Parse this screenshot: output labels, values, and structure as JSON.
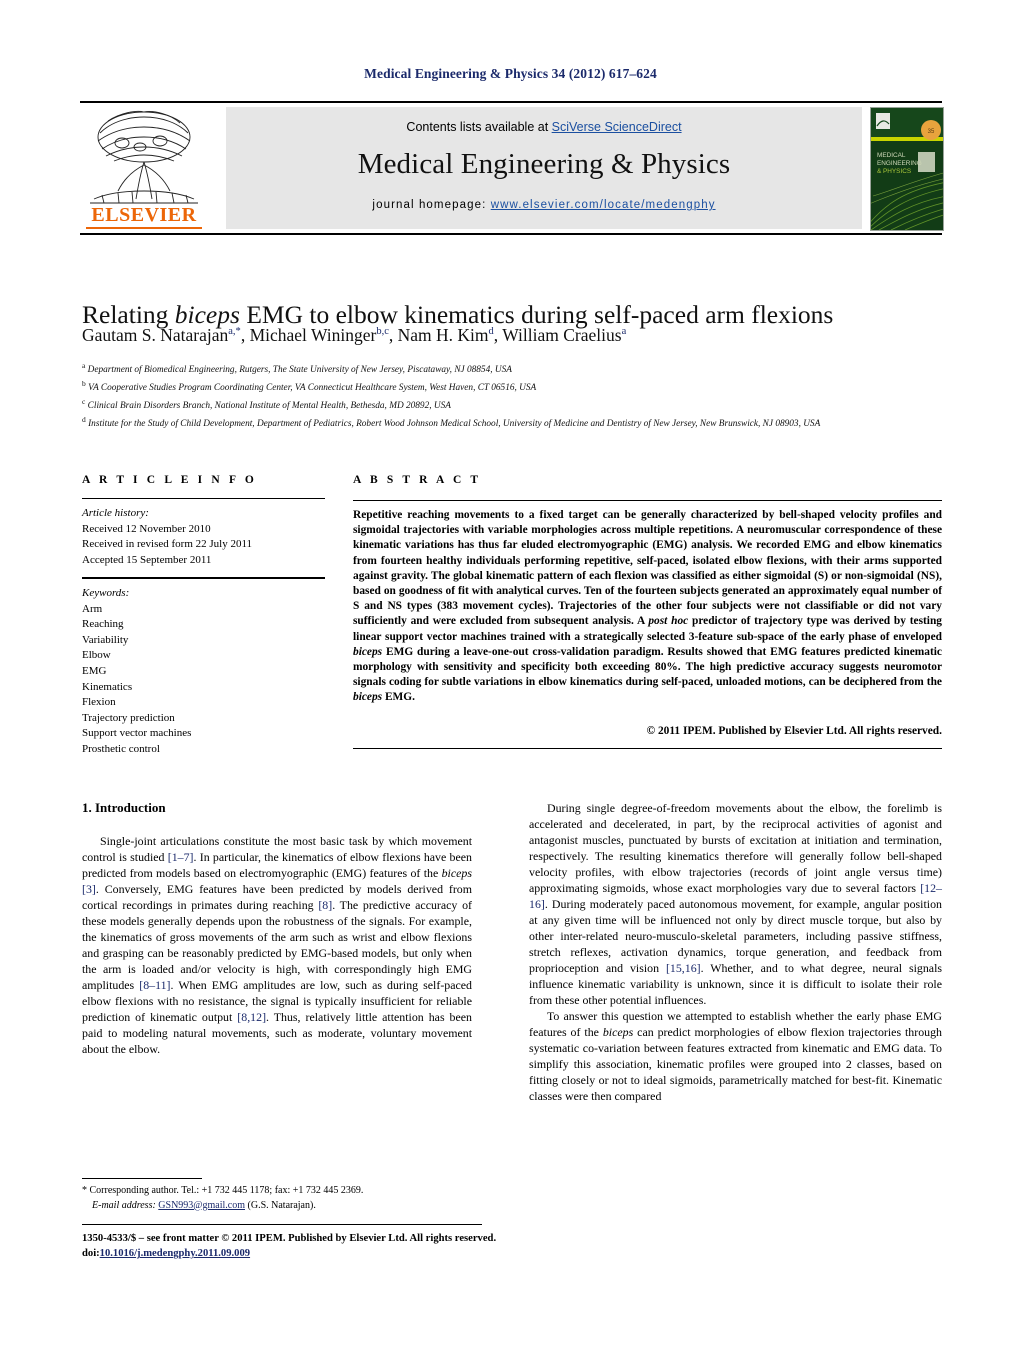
{
  "running_head": "Medical Engineering & Physics 34 (2012) 617–624",
  "banner": {
    "contents_prefix": "Contents lists available at ",
    "contents_link": "SciVerse ScienceDirect",
    "journal_title": "Medical Engineering & Physics",
    "homepage_prefix": "journal homepage: ",
    "homepage_url": "www.elsevier.com/locate/medengphy",
    "publisher_logo_text": "ELSEVIER",
    "cover_text_line1": "MEDICAL",
    "cover_text_line2": "ENGINEERING",
    "cover_text_line3": "& PHYSICS"
  },
  "article": {
    "title_part1": "Relating ",
    "title_italic": "biceps",
    "title_part2": " EMG to elbow kinematics during self-paced arm flexions",
    "authors_html": "Gautam S. Natarajan, Michael Wininger, Nam H. Kim, William Craelius",
    "affiliations": [
      {
        "marker": "a",
        "text": "Department of Biomedical Engineering, Rutgers, The State University of New Jersey, Piscataway, NJ 08854, USA"
      },
      {
        "marker": "b",
        "text": "VA Cooperative Studies Program Coordinating Center, VA Connecticut Healthcare System, West Haven, CT 06516, USA"
      },
      {
        "marker": "c",
        "text": "Clinical Brain Disorders Branch, National Institute of Mental Health, Bethesda, MD 20892, USA"
      },
      {
        "marker": "d",
        "text": "Institute for the Study of Child Development, Department of Pediatrics, Robert Wood Johnson Medical School, University of Medicine and Dentistry of New Jersey, New Brunswick, NJ 08903, USA"
      }
    ]
  },
  "article_info": {
    "heading": "A R T I C L E  I N F O",
    "history_label": "Article history:",
    "history": [
      "Received 12 November 2010",
      "Received in revised form 22 July 2011",
      "Accepted 15 September 2011"
    ],
    "keywords_label": "Keywords:",
    "keywords": [
      "Arm",
      "Reaching",
      "Variability",
      "Elbow",
      "EMG",
      "Kinematics",
      "Flexion",
      "Trajectory prediction",
      "Support vector machines",
      "Prosthetic control"
    ]
  },
  "abstract": {
    "heading": "A B S T R A C T",
    "body": "Repetitive reaching movements to a fixed target can be generally characterized by bell-shaped velocity profiles and sigmoidal trajectories with variable morphologies across multiple repetitions. A neuromuscular correspondence of these kinematic variations has thus far eluded electromyographic (EMG) analysis. We recorded EMG and elbow kinematics from fourteen healthy individuals performing repetitive, self-paced, isolated elbow flexions, with their arms supported against gravity. The global kinematic pattern of each flexion was classified as either sigmoidal (S) or non-sigmoidal (NS), based on goodness of fit with analytical curves. Ten of the fourteen subjects generated an approximately equal number of S and NS types (383 movement cycles). Trajectories of the other four subjects were not classifiable or did not vary sufficiently and were excluded from subsequent analysis. A post hoc predictor of trajectory type was derived by testing linear support vector machines trained with a strategically selected 3-feature sub-space of the early phase of enveloped biceps EMG during a leave-one-out cross-validation paradigm. Results showed that EMG features predicted kinematic morphology with sensitivity and specificity both exceeding 80%. The high predictive accuracy suggests neuromotor signals coding for subtle variations in elbow kinematics during self-paced, unloaded motions, can be deciphered from the biceps EMG.",
    "copyright": "© 2011 IPEM. Published by Elsevier Ltd. All rights reserved."
  },
  "body": {
    "intro_heading": "1. Introduction",
    "left_paragraph": "Single-joint articulations constitute the most basic task by which movement control is studied [1–7]. In particular, the kinematics of elbow flexions have been predicted from models based on electromyographic (EMG) features of the biceps [3]. Conversely, EMG features have been predicted by models derived from cortical recordings in primates during reaching [8]. The predictive accuracy of these models generally depends upon the robustness of the signals. For example, the kinematics of gross movements of the arm such as wrist and elbow flexions and grasping can be reasonably predicted by EMG-based models, but only when the arm is loaded and/or velocity is high, with correspondingly high EMG amplitudes [8–11]. When EMG amplitudes are low, such as during self-paced elbow flexions with no resistance, the signal is typically insufficient for reliable prediction of kinematic output [8,12]. Thus, relatively little attention has been paid to modeling natural movements, such as moderate, voluntary movement about the elbow.",
    "right_paragraph_1": "During single degree-of-freedom movements about the elbow, the forelimb is accelerated and decelerated, in part, by the reciprocal activities of agonist and antagonist muscles, punctuated by bursts of excitation at initiation and termination, respectively. The resulting kinematics therefore will generally follow bell-shaped velocity profiles, with elbow trajectories (records of joint angle versus time) approximating sigmoids, whose exact morphologies vary due to several factors [12–16]. During moderately paced autonomous movement, for example, angular position at any given time will be influenced not only by direct muscle torque, but also by other inter-related neuro-musculo-skeletal parameters, including passive stiffness, stretch reflexes, activation dynamics, torque generation, and feedback from proprioception and vision [15,16]. Whether, and to what degree, neural signals influence kinematic variability is unknown, since it is difficult to isolate their role from these other potential influences.",
    "right_paragraph_2": "To answer this question we attempted to establish whether the early phase EMG features of the biceps can predict morphologies of elbow flexion trajectories through systematic co-variation between features extracted from kinematic and EMG data. To simplify this association, kinematic profiles were grouped into 2 classes, based on fitting closely or not to ideal sigmoids, parametrically matched for best-fit. Kinematic classes were then compared"
  },
  "footnote": {
    "corresponding": "* Corresponding author. Tel.: +1 732 445 1178; fax: +1 732 445 2369.",
    "email_label": "E-mail address:",
    "email": "GSN993@gmail.com",
    "email_owner": "(G.S. Natarajan)."
  },
  "page_footer": {
    "issn_line": "1350-4533/$ – see front matter © 2011 IPEM. Published by Elsevier Ltd. All rights reserved.",
    "doi_label": "doi:",
    "doi_value": "10.1016/j.medengphy.2011.09.009"
  },
  "colors": {
    "link": "#1b4fa0",
    "reference": "#1b2a6b",
    "elsevier_orange": "#ec6608",
    "banner_gray": "#e6e6e6"
  }
}
